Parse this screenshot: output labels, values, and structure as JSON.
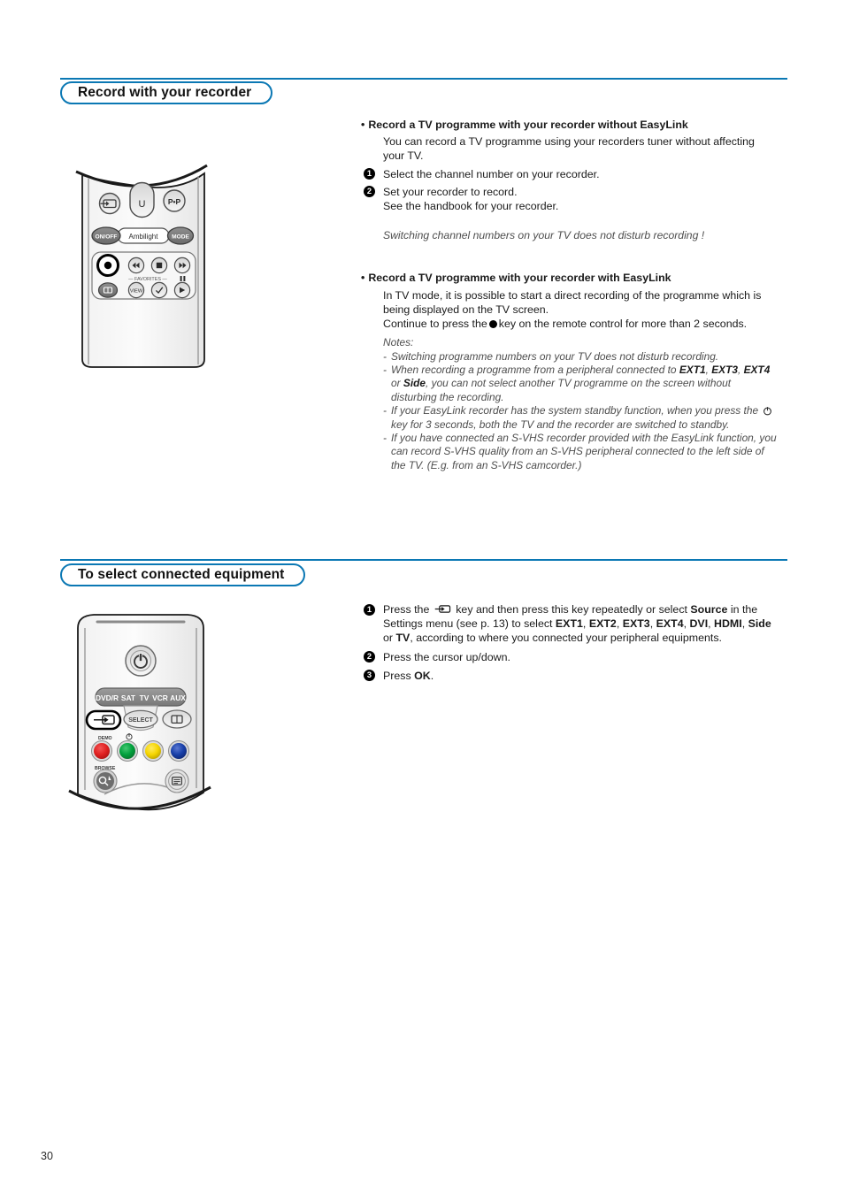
{
  "page": {
    "number": "30",
    "accent_color": "#0b78b4"
  },
  "sections": [
    {
      "id": "record",
      "title": "Record with your recorder",
      "blocks": {
        "without_easylink": {
          "heading": "Record a TV programme with your recorder without EasyLink",
          "paragraph": "You can record a TV programme using your recorders tuner without affecting your TV.",
          "steps": [
            {
              "num": "1",
              "text": "Select the channel number on your recorder."
            },
            {
              "num": "2",
              "text": "Set your recorder to record.\nSee the handbook for your recorder."
            }
          ],
          "note": "Switching channel numbers on your TV does not disturb recording !"
        },
        "with_easylink": {
          "heading": "Record a TV programme with your recorder with EasyLink",
          "paragraph_1": "In TV mode, it is possible to start a direct recording of the programme which is being displayed on the TV screen.",
          "paragraph_2_a": "Continue to press the",
          "paragraph_2_b": "key on the remote control for more than 2 seconds.",
          "notes_label": "Notes:",
          "notes": [
            "Switching programme numbers on your TV does not disturb recording.",
            "When recording a programme from a peripheral connected to EXT1, EXT3, EXT4 or Side, you can not select another TV programme on the screen without disturbing the recording.",
            "If your EasyLink recorder has the system standby function, when you press the  key for 3 seconds, both the TV and the recorder are switched to standby.",
            "If you have connected an S-VHS recorder provided with the EasyLink function, you can record S-VHS quality from an S-VHS peripheral connected to the left side of the TV. (E.g. from an S-VHS camcorder.)"
          ]
        }
      }
    },
    {
      "id": "select-equipment",
      "title": "To select connected equipment",
      "steps": [
        {
          "num": "1",
          "text_a": "Press the",
          "text_b": "key and then press this key repeatedly or select Source in the Settings menu (see p. 13) to select EXT1, EXT2, EXT3, EXT4, DVI, HDMI, Side or TV, according to where you connected your peripheral equipments."
        },
        {
          "num": "2",
          "text": "Press the cursor up/down."
        },
        {
          "num": "3",
          "text": "Press OK."
        }
      ]
    }
  ],
  "remote_top": {
    "keys_row1": [
      "source-icon",
      "U",
      "P•P"
    ],
    "keys_row2": [
      "ON/OFF",
      "Ambilight",
      "MODE"
    ],
    "favorites_label": "FAVORITES",
    "keys_transport": [
      "record",
      "rewind",
      "stop",
      "forward",
      "pause",
      "play"
    ],
    "keys_bottom": [
      "list",
      "VIEW",
      "check"
    ]
  },
  "remote_bottom": {
    "standby": "standby-icon",
    "mode_labels": [
      "DVD/R",
      "SAT",
      "TV",
      "VCR",
      "AUX"
    ],
    "select_label": "SELECT",
    "source_key": "source-icon",
    "info_key": "info-icon",
    "demo_label": "DEMO",
    "browse_label": "BROWSE",
    "color_buttons": [
      "#e02020",
      "#00a03c",
      "#f5d500",
      "#173fa8"
    ]
  }
}
